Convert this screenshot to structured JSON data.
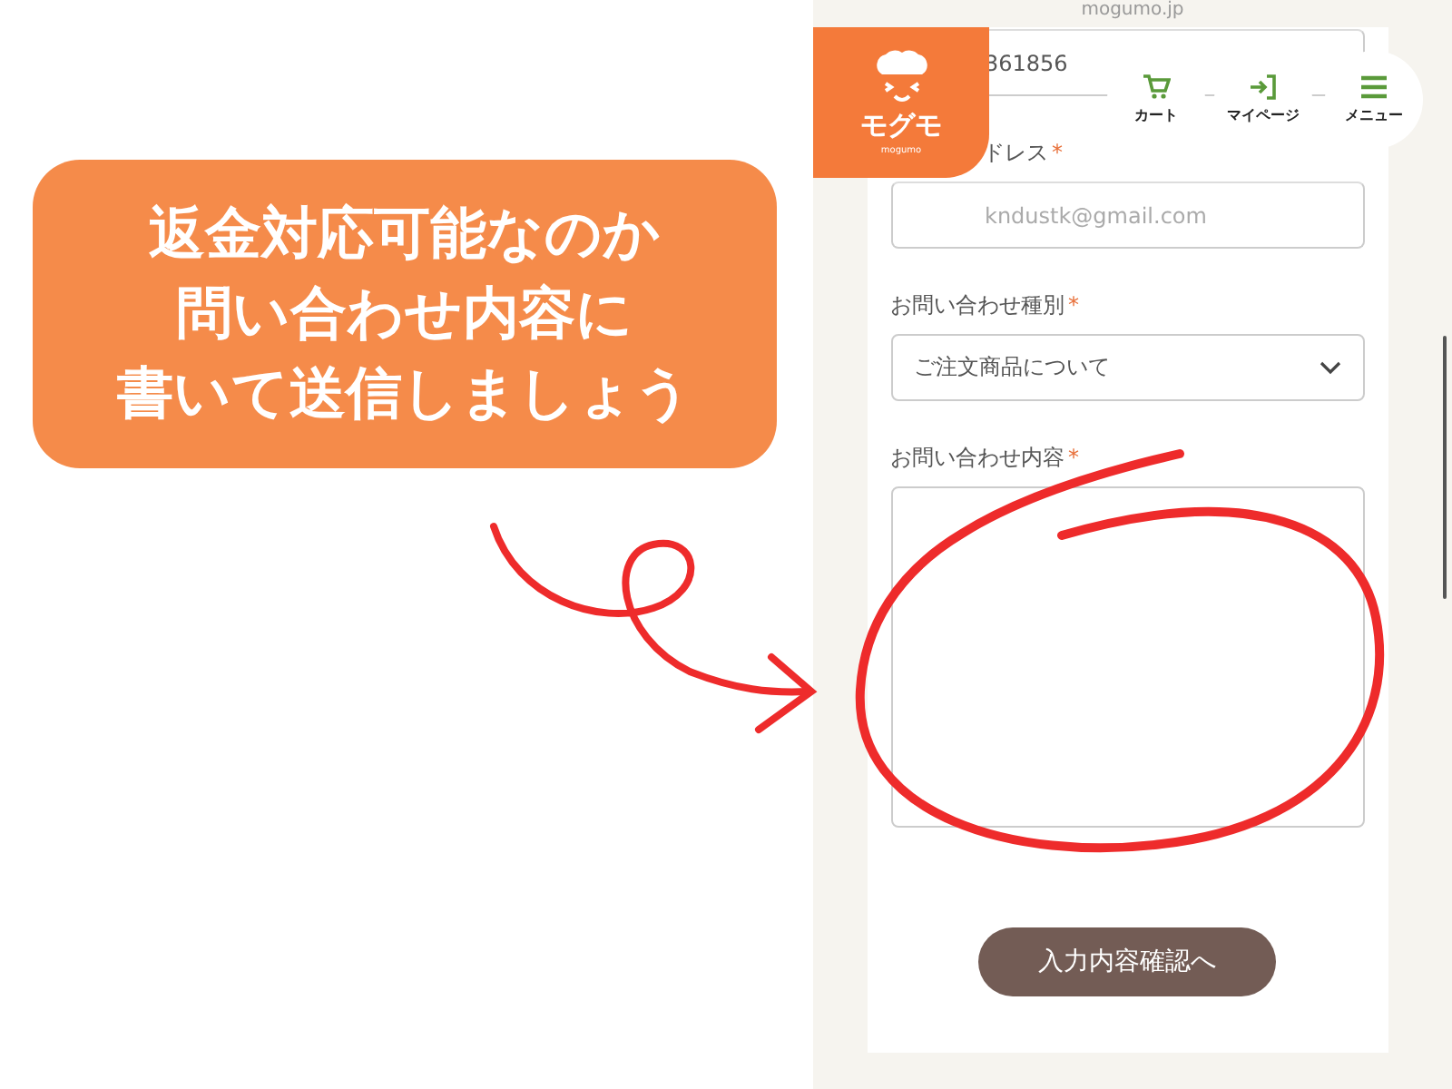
{
  "callout": {
    "lines": [
      "返金対応可能なのか",
      "問い合わせ内容に",
      "書いて送信しましょう"
    ]
  },
  "browser": {
    "url": "mogumo.jp"
  },
  "header": {
    "logo": "モグモ",
    "logo_sub": "mogumo",
    "nav": [
      {
        "kind": "cart",
        "label": "カート"
      },
      {
        "kind": "login",
        "label": "マイページ"
      },
      {
        "kind": "menu",
        "label": "メニュー"
      }
    ]
  },
  "form": {
    "fields": [
      {
        "kind": "text",
        "value": "361856",
        "partly_hidden": true
      },
      {
        "kind": "text",
        "label": "ドレス",
        "required_mark": "*",
        "placeholder": "kndustk@gmail.com",
        "partly_hidden": true
      },
      {
        "kind": "select",
        "label": "お問い合わせ種別",
        "required_mark": "*",
        "value": "ご注文商品について"
      },
      {
        "kind": "textarea",
        "label": "お問い合わせ内容",
        "required_mark": "*"
      }
    ],
    "submit": "入力内容確認へ"
  }
}
